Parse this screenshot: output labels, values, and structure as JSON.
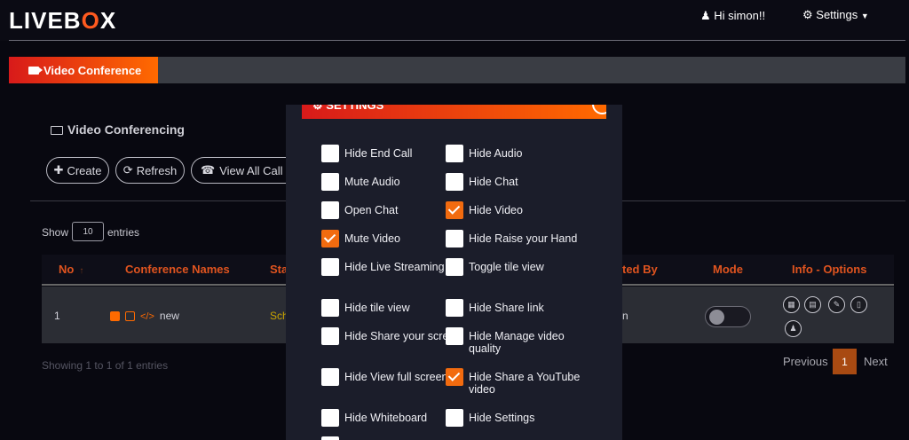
{
  "brand": {
    "pre": "LIVEB",
    "x": "O",
    "post": "X",
    "accent": "#ff5a1f"
  },
  "header": {
    "greeting": "Hi simon!!",
    "settings_label": "Settings"
  },
  "tabs": {
    "active_label": "Video Conference"
  },
  "panel": {
    "title": "Video Conferencing",
    "buttons": {
      "create": "Create",
      "refresh": "Refresh",
      "view_call_logs": "View All Call Lo"
    },
    "show_label": "Show",
    "page_size": "10",
    "entries_label": "entries"
  },
  "table": {
    "headers": {
      "no": "No",
      "names": "Conference Names",
      "status": "Sta",
      "created_by": "ted By",
      "mode": "Mode",
      "info": "Info - Options"
    },
    "row": {
      "no": "1",
      "name": "new",
      "status": "Sch",
      "created": "n"
    },
    "showing": "Showing 1 to 1 of 1 entries",
    "pagination": {
      "previous": "Previous",
      "current": "1",
      "next": "Next"
    }
  },
  "modal": {
    "title": "SETTINGS",
    "options": [
      {
        "label": "Hide End Call",
        "checked": false
      },
      {
        "label": "Hide Audio",
        "checked": false
      },
      {
        "label": "Mute Audio",
        "checked": false
      },
      {
        "label": "Hide Chat",
        "checked": false
      },
      {
        "label": "Open Chat",
        "checked": false
      },
      {
        "label": "Hide Video",
        "checked": true
      },
      {
        "label": "Mute Video",
        "checked": true
      },
      {
        "label": "Hide Raise your Hand",
        "checked": false
      },
      {
        "label": "Hide Live Streaming",
        "checked": false
      },
      {
        "label": "Toggle tile view",
        "checked": false
      },
      {
        "label": "Hide tile view",
        "checked": false
      },
      {
        "label": "Hide Share link",
        "checked": false
      },
      {
        "label": "Hide Share your screen",
        "checked": false
      },
      {
        "label": "Hide Manage video quality",
        "checked": false
      },
      {
        "label": "Hide View full screen",
        "checked": false
      },
      {
        "label": "Hide Share a YouTube video",
        "checked": true
      },
      {
        "label": "Hide Whiteboard",
        "checked": false
      },
      {
        "label": "Hide Settings",
        "checked": false
      }
    ]
  }
}
